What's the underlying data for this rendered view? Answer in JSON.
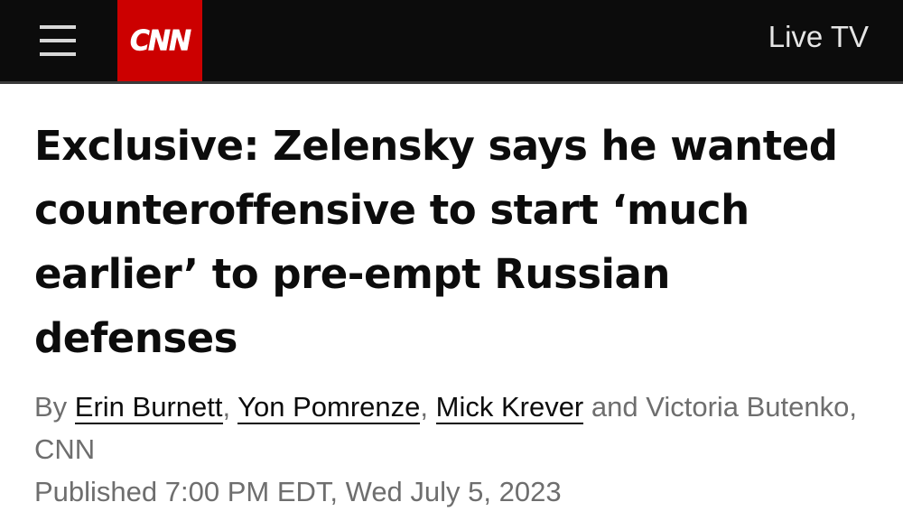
{
  "header": {
    "menu_icon": "hamburger-menu-icon",
    "logo_text": "CNN",
    "live_tv_label": "Live TV",
    "brand_color": "#cc0000",
    "bar_color": "#0c0c0c"
  },
  "article": {
    "headline": "Exclusive: Zelensky says he wanted counteroffensive to start ‘much earlier’ to pre-empt Russian defenses",
    "byline": {
      "prefix": "By ",
      "authors": [
        "Erin Burnett",
        "Yon Pomrenze",
        "Mick Krever"
      ],
      "separator": ", ",
      "and_text": " and Victoria Butenko, CNN"
    },
    "published": "Published 7:00 PM EDT, Wed July 5, 2023"
  }
}
